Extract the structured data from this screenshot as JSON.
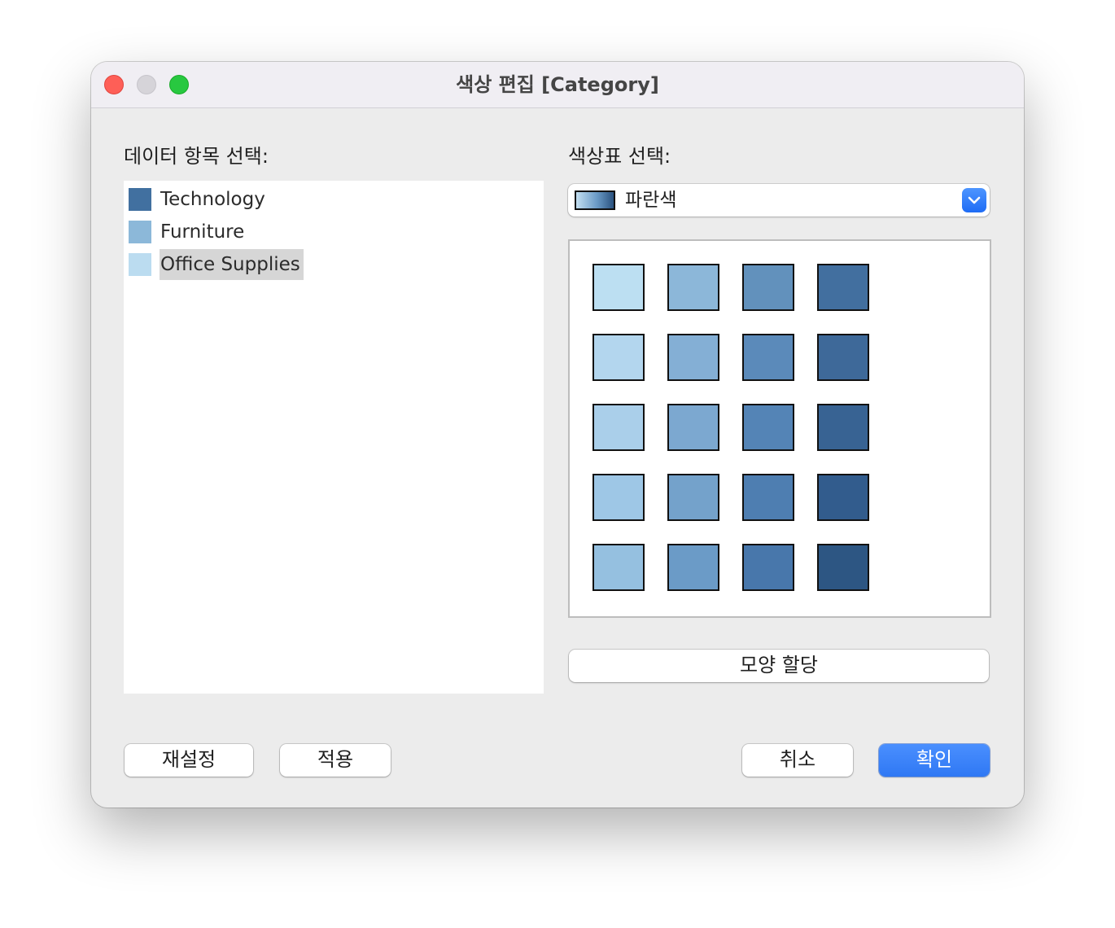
{
  "window": {
    "title": "색상 편집 [Category]"
  },
  "left_panel": {
    "label": "데이터 항목 선택:",
    "items": [
      {
        "label": "Technology",
        "color": "#4170a0",
        "selected": false
      },
      {
        "label": "Furniture",
        "color": "#8cb8d9",
        "selected": false
      },
      {
        "label": "Office Supplies",
        "color": "#bbdcf0",
        "selected": true
      }
    ]
  },
  "right_panel": {
    "label": "색상표 선택:",
    "palette_dropdown": {
      "value": "파란색",
      "icon": "gradient-swatch"
    },
    "palette_colors": [
      [
        "#bcdff2",
        "#8cb7d9",
        "#6291bc",
        "#426f9f"
      ],
      [
        "#b3d6ee",
        "#84afd5",
        "#5b8aba",
        "#3e6999"
      ],
      [
        "#aacfea",
        "#7ca8d0",
        "#5484b6",
        "#386393"
      ],
      [
        "#9ec7e6",
        "#74a2cb",
        "#4e7eb1",
        "#325c8d"
      ],
      [
        "#95c0e0",
        "#6b9bc7",
        "#4877ab",
        "#2d5683"
      ]
    ],
    "shape_button_label": "모양 할당"
  },
  "footer": {
    "reset_label": "재설정",
    "apply_label": "적용",
    "cancel_label": "취소",
    "ok_label": "확인"
  },
  "colors": {
    "accent": "#2f78f4",
    "close": "#fe5f57",
    "minimize": "#d6d4d9",
    "maximize": "#28c840"
  }
}
